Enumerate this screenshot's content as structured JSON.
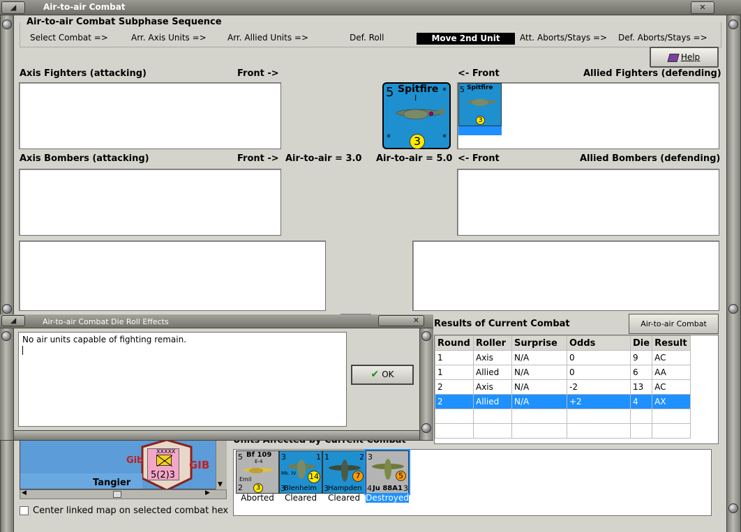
{
  "window": {
    "title": "Air-to-air Combat"
  },
  "sequence": {
    "title": "Air-to-air Combat Subphase Sequence",
    "steps": [
      "Select Combat =>",
      "Arr. Axis Units =>",
      "Arr. Allied Units =>",
      "Def. Roll",
      "Move 2nd Unit",
      "Att. Aborts/Stays =>",
      "Def. Aborts/Stays =>"
    ],
    "active_index": 4
  },
  "help_label": "Help",
  "sections": {
    "axis_fighters": "Axis Fighters (attacking)",
    "axis_fighters_front": "Front ->",
    "allied_fighters_front": "<- Front",
    "allied_fighters": "Allied Fighters (defending)",
    "axis_bombers": "Axis Bombers (attacking)",
    "axis_bombers_front": "Front ->",
    "axis_air_to_air": "Air-to-air = 3.0",
    "allied_air_to_air": "Air-to-air = 5.0",
    "allied_bombers_front": "<- Front",
    "allied_bombers": "Allied Bombers (defending)"
  },
  "selected_unit": {
    "name": "Spitfire",
    "model": "I",
    "attack": "5",
    "defense": "3",
    "star": "*"
  },
  "allied_fighter_unit": {
    "name": "Spitfire",
    "attack": "5",
    "defense": "3"
  },
  "die_roll": {
    "title": "Air-to-air Combat Die Roll Effects",
    "message": "No air units capable of fighting remain.",
    "ok_label": "OK"
  },
  "results": {
    "title": "Results of Current Combat",
    "chart_button": "Air-to-air Combat Chart",
    "columns": [
      "Round",
      "Roller",
      "Surprise",
      "Odds",
      "Die",
      "Result"
    ],
    "rows": [
      [
        "1",
        "Axis",
        "N/A",
        "0",
        "9",
        "AC"
      ],
      [
        "1",
        "Allied",
        "N/A",
        "0",
        "6",
        "AA"
      ],
      [
        "2",
        "Axis",
        "N/A",
        "-2",
        "13",
        "AC"
      ],
      [
        "2",
        "Allied",
        "N/A",
        "+2",
        "4",
        "AX"
      ]
    ],
    "selected_row": 3
  },
  "map": {
    "label_gib_a": "Gib",
    "label_gib_b": "GIB",
    "label_tangier": "Tangier",
    "counter_value": "5(2)3",
    "counter_top": "XXXXX"
  },
  "center_map_label": "Center linked map on selected combat hex",
  "affected": {
    "title": "Units Affected by Current Combat",
    "units": [
      {
        "name": "Bf 109",
        "sub": "E-4",
        "pilot": "Emil",
        "left": "5",
        "bottom_left": "2",
        "circle": "3",
        "status": "Aborted"
      },
      {
        "name": "Blenheim",
        "sub": "Mk. IV",
        "left": "3",
        "right": "1",
        "bottom_left": "3",
        "circle": "14",
        "status": "Cleared"
      },
      {
        "name": "Hampden",
        "left": "1",
        "right": "2",
        "bottom_left": "3",
        "circle": "7",
        "status": "Cleared"
      },
      {
        "name": "Ju 88A1",
        "left": "3",
        "bottom_left": "4",
        "bottom_right": "3",
        "circle": "5",
        "status": "Destroyed"
      }
    ],
    "selected_index": 3
  },
  "colors": {
    "unit_blue": "#1e90d0",
    "selection_blue": "#1e90ff",
    "axis_gray": "#b4b4b4",
    "circle_yellow": "#ffeb00",
    "circle_orange": "#ff9a00"
  }
}
